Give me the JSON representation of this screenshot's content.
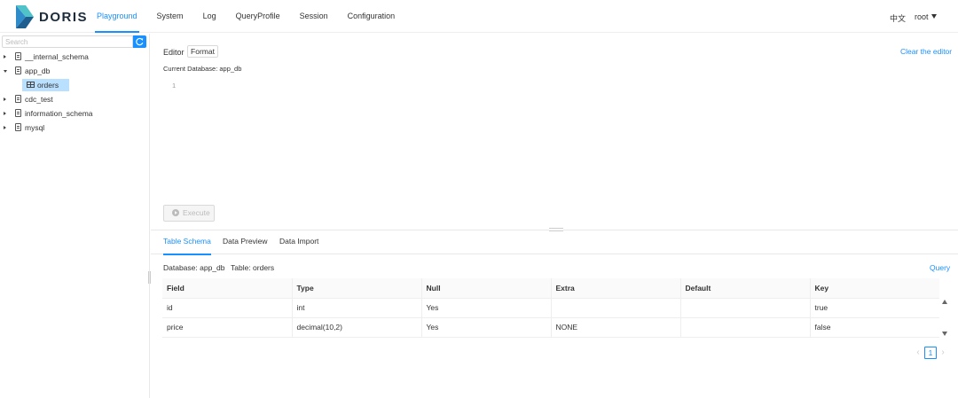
{
  "brand": {
    "name": "DORIS"
  },
  "nav": {
    "items": [
      {
        "label": "Playground",
        "active": true
      },
      {
        "label": "System",
        "active": false
      },
      {
        "label": "Log",
        "active": false
      },
      {
        "label": "QueryProfile",
        "active": false
      },
      {
        "label": "Session",
        "active": false
      },
      {
        "label": "Configuration",
        "active": false
      }
    ],
    "language": "中文",
    "user": "root"
  },
  "sidebar": {
    "search_placeholder": "Search",
    "tree": [
      {
        "label": "__internal_schema",
        "expanded": false
      },
      {
        "label": "app_db",
        "expanded": true,
        "children": [
          {
            "label": "orders",
            "selected": true
          }
        ]
      },
      {
        "label": "cdc_test",
        "expanded": false
      },
      {
        "label": "information_schema",
        "expanded": false
      },
      {
        "label": "mysql",
        "expanded": false
      }
    ]
  },
  "editor": {
    "label": "Editor",
    "format_label": "Format",
    "clear_label": "Clear the editor",
    "current_db": "Current Database: app_db",
    "line_number": "1",
    "execute_label": "Execute"
  },
  "result": {
    "tabs": [
      {
        "label": "Table Schema",
        "active": true
      },
      {
        "label": "Data Preview",
        "active": false
      },
      {
        "label": "Data Import",
        "active": false
      }
    ],
    "database_info": "Database: app_db",
    "table_info": "Table: orders",
    "query_label": "Query",
    "columns": [
      "Field",
      "Type",
      "Null",
      "Extra",
      "Default",
      "Key"
    ],
    "rows": [
      [
        "id",
        "int",
        "Yes",
        "",
        "",
        "true"
      ],
      [
        "price",
        "decimal(10,2)",
        "Yes",
        "NONE",
        "",
        "false"
      ]
    ],
    "pagination": {
      "current_page": "1",
      "prev": "‹",
      "next": "›"
    }
  },
  "colors": {
    "accent": "#1890ff",
    "selected_bg": "#bae0ff"
  },
  "icons": [
    "doris-logo",
    "refresh-icon",
    "caret-down-icon",
    "caret-right-icon",
    "database-icon",
    "table-icon",
    "play-circle-icon"
  ]
}
